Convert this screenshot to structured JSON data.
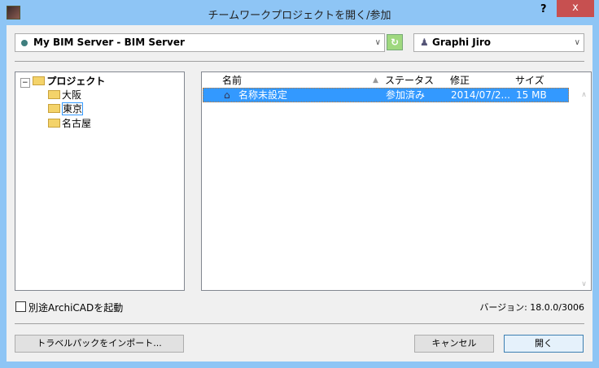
{
  "window": {
    "title": "チームワークプロジェクトを開く/参加",
    "help": "?",
    "close": "x"
  },
  "server": {
    "value": "My BIM Server - BIM Server"
  },
  "user": {
    "value": "Graphi Jiro"
  },
  "tree": {
    "root": "プロジェクト",
    "children": [
      "大阪",
      "東京",
      "名古屋"
    ]
  },
  "list": {
    "headers": [
      "名前",
      "ステータス",
      "修正",
      "サイズ"
    ],
    "rows": [
      {
        "name": "名称未設定",
        "status": "参加済み",
        "modified": "2014/07/2...",
        "size": "15 MB"
      }
    ]
  },
  "checkbox_label": "別途ArchiCADを起動",
  "version": "バージョン: 18.0.0/3006",
  "buttons": {
    "import": "トラベルパックをインポート...",
    "cancel": "キャンセル",
    "open": "開く"
  }
}
